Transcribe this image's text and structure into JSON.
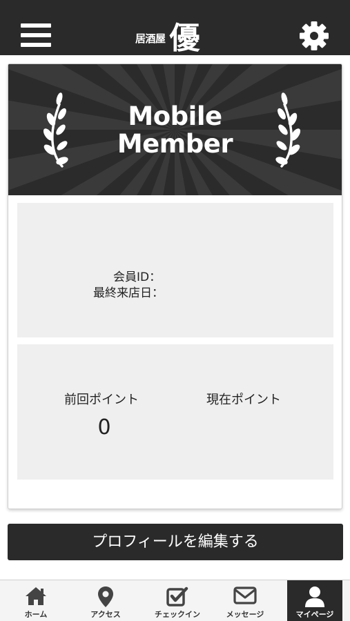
{
  "header": {
    "logo_sub": "居酒屋",
    "logo_main": "優",
    "menu_icon": "hamburger-icon",
    "settings_icon": "gear-icon"
  },
  "card": {
    "banner_line1": "Mobile",
    "banner_line2": "Member",
    "member_id_label": "会員ID：",
    "last_visit_label": "最終来店日：",
    "previous_points_label": "前回ポイント",
    "previous_points_value": "0",
    "current_points_label": "現在ポイント"
  },
  "edit_profile_button": "プロフィールを編集する",
  "bottom_nav": {
    "items": [
      {
        "label": "ホーム",
        "icon": "home-icon"
      },
      {
        "label": "アクセス",
        "icon": "map-pin-icon"
      },
      {
        "label": "チェックイン",
        "icon": "checkbox-icon"
      },
      {
        "label": "メッセージ",
        "icon": "envelope-icon"
      },
      {
        "label": "マイページ",
        "icon": "user-icon"
      }
    ],
    "active_index": 4
  },
  "colors": {
    "header_bg": "#2a2a2a",
    "panel_bg": "#efefef",
    "active_tab_bg": "#2a2a2a"
  }
}
